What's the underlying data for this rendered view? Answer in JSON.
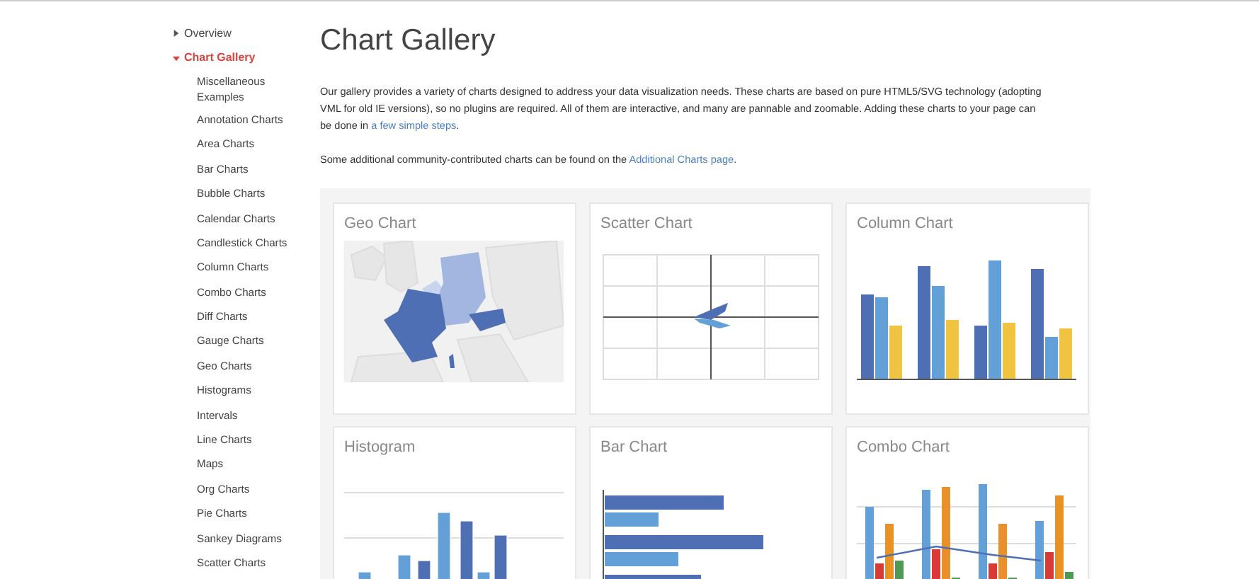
{
  "sidebar": {
    "items": [
      {
        "label": "Overview",
        "expanded": false,
        "selected": false
      },
      {
        "label": "Chart Gallery",
        "expanded": true,
        "selected": true,
        "children": [
          {
            "label": "Miscellaneous Examples",
            "selected": false
          },
          {
            "label": "Annotation Charts",
            "selected": false
          },
          {
            "label": "Area Charts",
            "selected": false
          },
          {
            "label": "Bar Charts",
            "selected": false
          },
          {
            "label": "Bubble Charts",
            "selected": false
          },
          {
            "label": "Calendar Charts",
            "selected": false
          },
          {
            "label": "Candlestick Charts",
            "selected": false
          },
          {
            "label": "Column Charts",
            "selected": false
          },
          {
            "label": "Combo Charts",
            "selected": false
          },
          {
            "label": "Diff Charts",
            "selected": false
          },
          {
            "label": "Gauge Charts",
            "selected": false
          },
          {
            "label": "Geo Charts",
            "selected": false
          },
          {
            "label": "Histograms",
            "selected": false
          },
          {
            "label": "Intervals",
            "selected": false
          },
          {
            "label": "Line Charts",
            "selected": false
          },
          {
            "label": "Maps",
            "selected": false
          },
          {
            "label": "Org Charts",
            "selected": false
          },
          {
            "label": "Pie Charts",
            "selected": false
          },
          {
            "label": "Sankey Diagrams",
            "selected": false
          },
          {
            "label": "Scatter Charts",
            "selected": false
          }
        ]
      }
    ]
  },
  "page": {
    "title": "Chart Gallery",
    "paragraphs": [
      [
        {
          "text": "Our gallery provides a variety of charts designed to address your data visualization needs. These charts are based on pure HTML5/SVG technology (adopting VML for old IE versions), so no plugins are required. All of them are interactive, and many are pannable and zoomable. Adding these charts to your page can be done in ",
          "link": false
        },
        {
          "text": "a few simple steps",
          "link": true
        },
        {
          "text": ".",
          "link": false
        }
      ],
      [
        {
          "text": "Some additional community-contributed charts can be found on the ",
          "link": false
        },
        {
          "text": "Additional Charts page",
          "link": true
        },
        {
          "text": ".",
          "link": false
        }
      ]
    ]
  },
  "gallery": [
    {
      "title": "Geo Chart",
      "kind": "geo"
    },
    {
      "title": "Scatter Chart",
      "kind": "scatter"
    },
    {
      "title": "Column Chart",
      "kind": "column"
    },
    {
      "title": "Histogram",
      "kind": "histogram"
    },
    {
      "title": "Bar Chart",
      "kind": "bar"
    },
    {
      "title": "Combo Chart",
      "kind": "combo"
    }
  ]
}
